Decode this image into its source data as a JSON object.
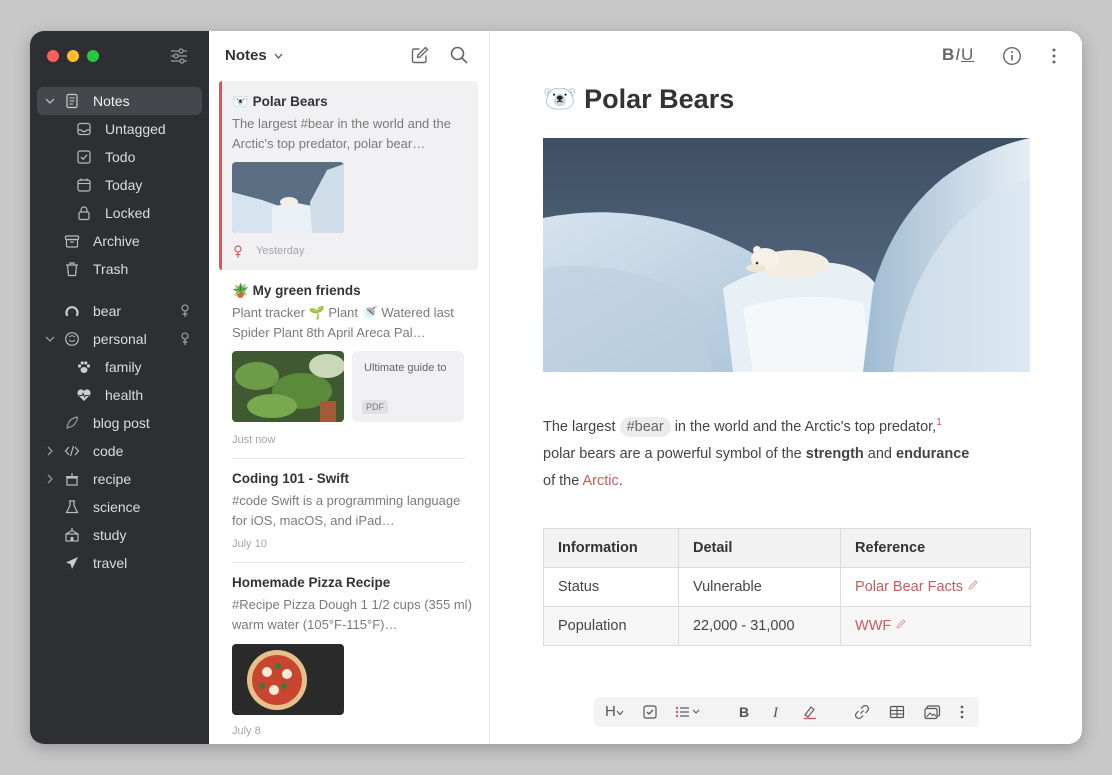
{
  "sidebar": {
    "items": [
      {
        "label": "Notes",
        "icon": "notes-icon"
      },
      {
        "label": "Untagged",
        "icon": "inbox-icon"
      },
      {
        "label": "Todo",
        "icon": "checkbox-icon"
      },
      {
        "label": "Today",
        "icon": "calendar-icon"
      },
      {
        "label": "Locked",
        "icon": "lock-icon"
      },
      {
        "label": "Archive",
        "icon": "archive-icon"
      },
      {
        "label": "Trash",
        "icon": "trash-icon"
      }
    ],
    "tags": [
      {
        "label": "bear",
        "icon": "bear-tag-icon"
      },
      {
        "label": "personal",
        "icon": "personal-tag-icon"
      },
      {
        "label": "family",
        "icon": "paw-icon"
      },
      {
        "label": "health",
        "icon": "heart-icon"
      },
      {
        "label": "blog post",
        "icon": "feather-icon"
      },
      {
        "label": "code",
        "icon": "code-icon"
      },
      {
        "label": "recipe",
        "icon": "recipe-icon"
      },
      {
        "label": "science",
        "icon": "flask-icon"
      },
      {
        "label": "study",
        "icon": "school-icon"
      },
      {
        "label": "travel",
        "icon": "plane-icon"
      }
    ]
  },
  "notelist": {
    "title": "Notes",
    "notes": [
      {
        "emoji": "🐻‍❄️",
        "title": "Polar Bears",
        "excerpt": "The largest #bear in the world and the Arctic's top predator, polar bear…",
        "date": "Yesterday"
      },
      {
        "emoji": "🪴",
        "title": "My green friends",
        "excerpt": "Plant tracker 🌱 Plant 🚿 Watered last Spider Plant 8th April Areca Pal…",
        "date": "Just now",
        "pdf_title": "Ultimate guide to",
        "pdf_badge": "PDF"
      },
      {
        "title": "Coding 101 - Swift",
        "excerpt": "#code Swift is a programming language for iOS, macOS, and iPad…",
        "date": "July 10"
      },
      {
        "title": "Homemade Pizza Recipe",
        "excerpt": "#Recipe Pizza Dough 1 1/2 cups (355 ml) warm water (105°F-115°F)…",
        "date": "July 8"
      }
    ]
  },
  "editor": {
    "format_label": {
      "b": "B",
      "i": "I",
      "u": "U"
    },
    "emoji": "🐻‍❄️",
    "title": "Polar Bears",
    "body": {
      "t1": "The largest",
      "hashtag": "#bear",
      "t2": "in the world and the Arctic's top predator,",
      "footnote": "1",
      "t3": "polar bears are a powerful symbol of the",
      "strong1": "strength",
      "t4": "and",
      "strong2": "endurance",
      "t5": "of the",
      "link": "Arctic",
      "t6": "."
    },
    "table": {
      "headers": [
        "Information",
        "Detail",
        "Reference"
      ],
      "rows": [
        [
          "Status",
          "Vulnerable",
          "Polar Bear Facts"
        ],
        [
          "Population",
          "22,000 - 31,000",
          "WWF"
        ]
      ]
    },
    "toolbar": {
      "heading": "H"
    }
  },
  "colors": {
    "accent": "#d35a58",
    "sidebar_bg": "#2d2f33",
    "link": "#c75b5b"
  }
}
